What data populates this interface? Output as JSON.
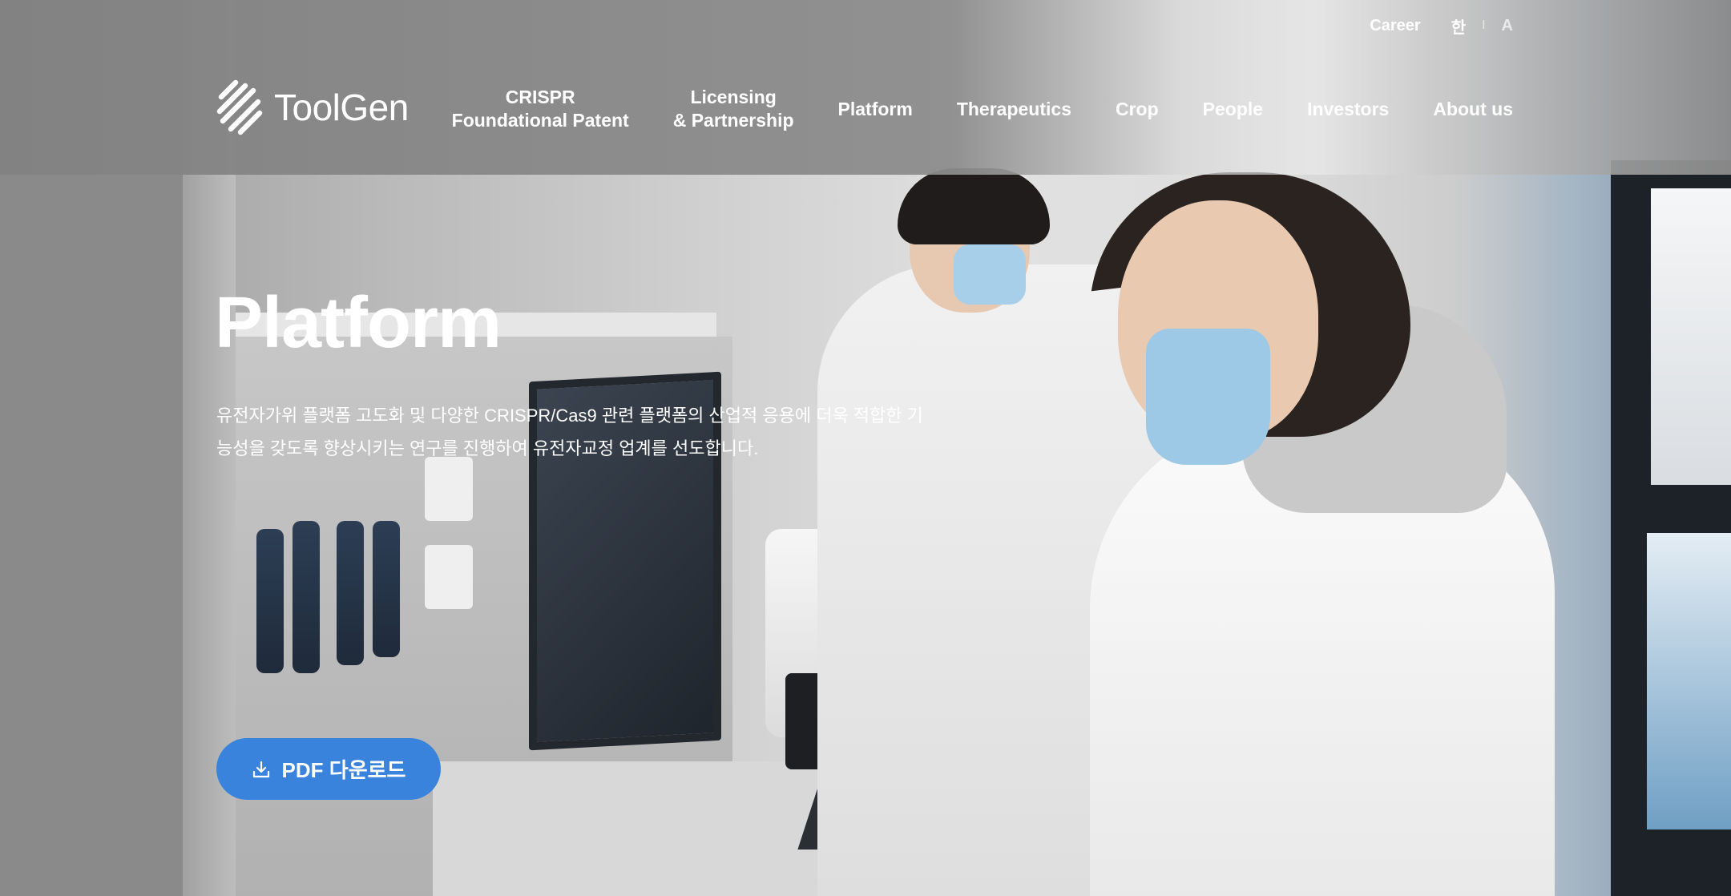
{
  "utility_nav": {
    "career": "Career",
    "lang_ko": "한",
    "separator": "I",
    "lang_en": "A"
  },
  "logo": {
    "text": "ToolGen",
    "icon": "toolgen-logo-icon"
  },
  "main_nav": {
    "items": [
      {
        "line1": "CRISPR",
        "line2": "Foundational Patent"
      },
      {
        "line1": "Licensing",
        "line2": "& Partnership"
      },
      {
        "line1": "Platform",
        "line2": ""
      },
      {
        "line1": "Therapeutics",
        "line2": ""
      },
      {
        "line1": "Crop",
        "line2": ""
      },
      {
        "line1": "People",
        "line2": ""
      },
      {
        "line1": "Investors",
        "line2": ""
      },
      {
        "line1": "About us",
        "line2": ""
      }
    ]
  },
  "hero": {
    "title": "Platform",
    "description_line1": "유전자가위 플랫폼 고도화 및 다양한 CRISPR/Cas9 관련 플랫폼의 산업적 응용에 더욱 적합한 기",
    "description_line2": "능성을 갖도록 향상시키는 연구를 진행하여 유전자교정 업계를 선도합니다.",
    "pdf_button_label": "PDF 다운로드",
    "pdf_button_icon": "download-icon"
  },
  "colors": {
    "button_blue": "#3a83dd",
    "text_white": "#ffffff"
  }
}
